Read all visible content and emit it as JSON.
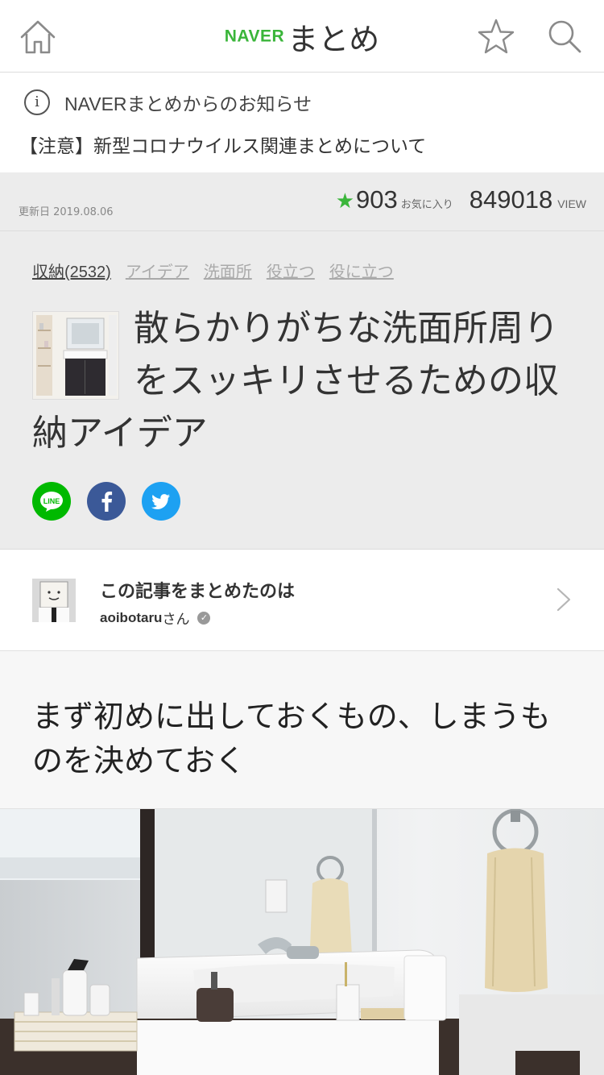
{
  "header": {
    "logo_naver": "NAVER",
    "logo_matome": "まとめ",
    "icons": [
      "home-icon",
      "star-outline-icon",
      "search-icon"
    ]
  },
  "notice": {
    "title": "NAVERまとめからのお知らせ",
    "link": "【注意】新型コロナウイルス関連まとめについて"
  },
  "meta": {
    "updated": "更新日 2019.08.06",
    "favorites_count": "903",
    "favorites_label": "お気に入り",
    "view_count": "849018",
    "view_label": "VIEW"
  },
  "article": {
    "tags": [
      "収納(2532)",
      "アイデア",
      "洗面所",
      "役立つ",
      "役に立つ"
    ],
    "title": "散らかりがちな洗面所周りをスッキリさせるための収納アイデア",
    "share": [
      "line-icon",
      "facebook-icon",
      "twitter-icon"
    ],
    "line_label": "LINE"
  },
  "author": {
    "label": "この記事をまとめたのは",
    "name": "aoibotaru",
    "suffix": "さん"
  },
  "section": {
    "heading": "まず初めに出しておくもの、しまうものを決めておく"
  },
  "colors": {
    "brand_green": "#3ab53a",
    "line_green": "#00b900",
    "facebook_blue": "#3b5998",
    "twitter_blue": "#1da1f2"
  }
}
